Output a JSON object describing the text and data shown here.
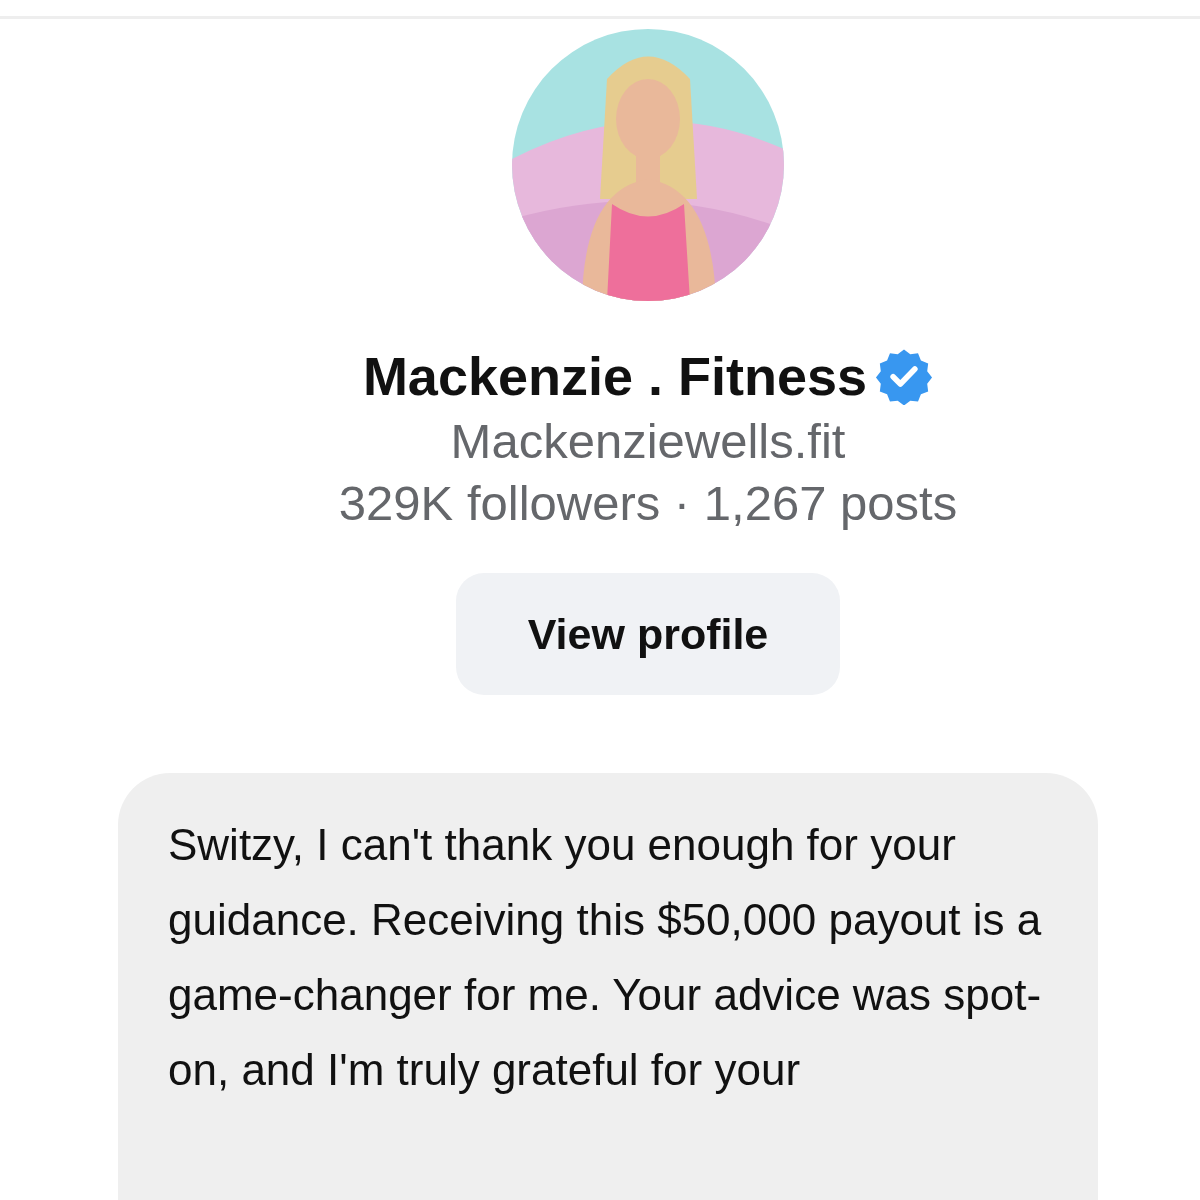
{
  "profile": {
    "name": "Mackenzie . Fitness",
    "verified": true,
    "username": "Mackenziewells.fit",
    "stats": "329K followers · 1,267 posts"
  },
  "view_profile_button": {
    "label": "View profile"
  },
  "messages": [
    {
      "text": "Switzy, I can't thank you enough for your guidance. Receiving this $50,000 payout is a game-changer for me. Your advice was spot-on, and I'm truly grateful for your"
    }
  ]
}
